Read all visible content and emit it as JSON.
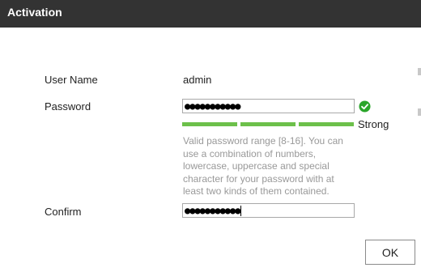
{
  "dialog": {
    "title": "Activation"
  },
  "form": {
    "user_name": {
      "label": "User Name",
      "value": "admin"
    },
    "password": {
      "label": "Password",
      "masked_value": "●●●●●●●●●●●",
      "strength_label": "Strong",
      "strength_level": "3 of 3",
      "hint": "Valid password range [8-16]. You can use a combination of numbers, lowercase, uppercase and special character for your password with at least two kinds of them contained."
    },
    "confirm": {
      "label": "Confirm",
      "masked_value": "●●●●●●●●●●●"
    }
  },
  "actions": {
    "ok_label": "OK"
  },
  "icons": {
    "valid_check": "check-circle-icon"
  },
  "colors": {
    "titlebar_bg": "#333333",
    "strength_bar": "#6cc04a",
    "valid_icon": "#2aa52a",
    "hint_text": "#999999"
  }
}
